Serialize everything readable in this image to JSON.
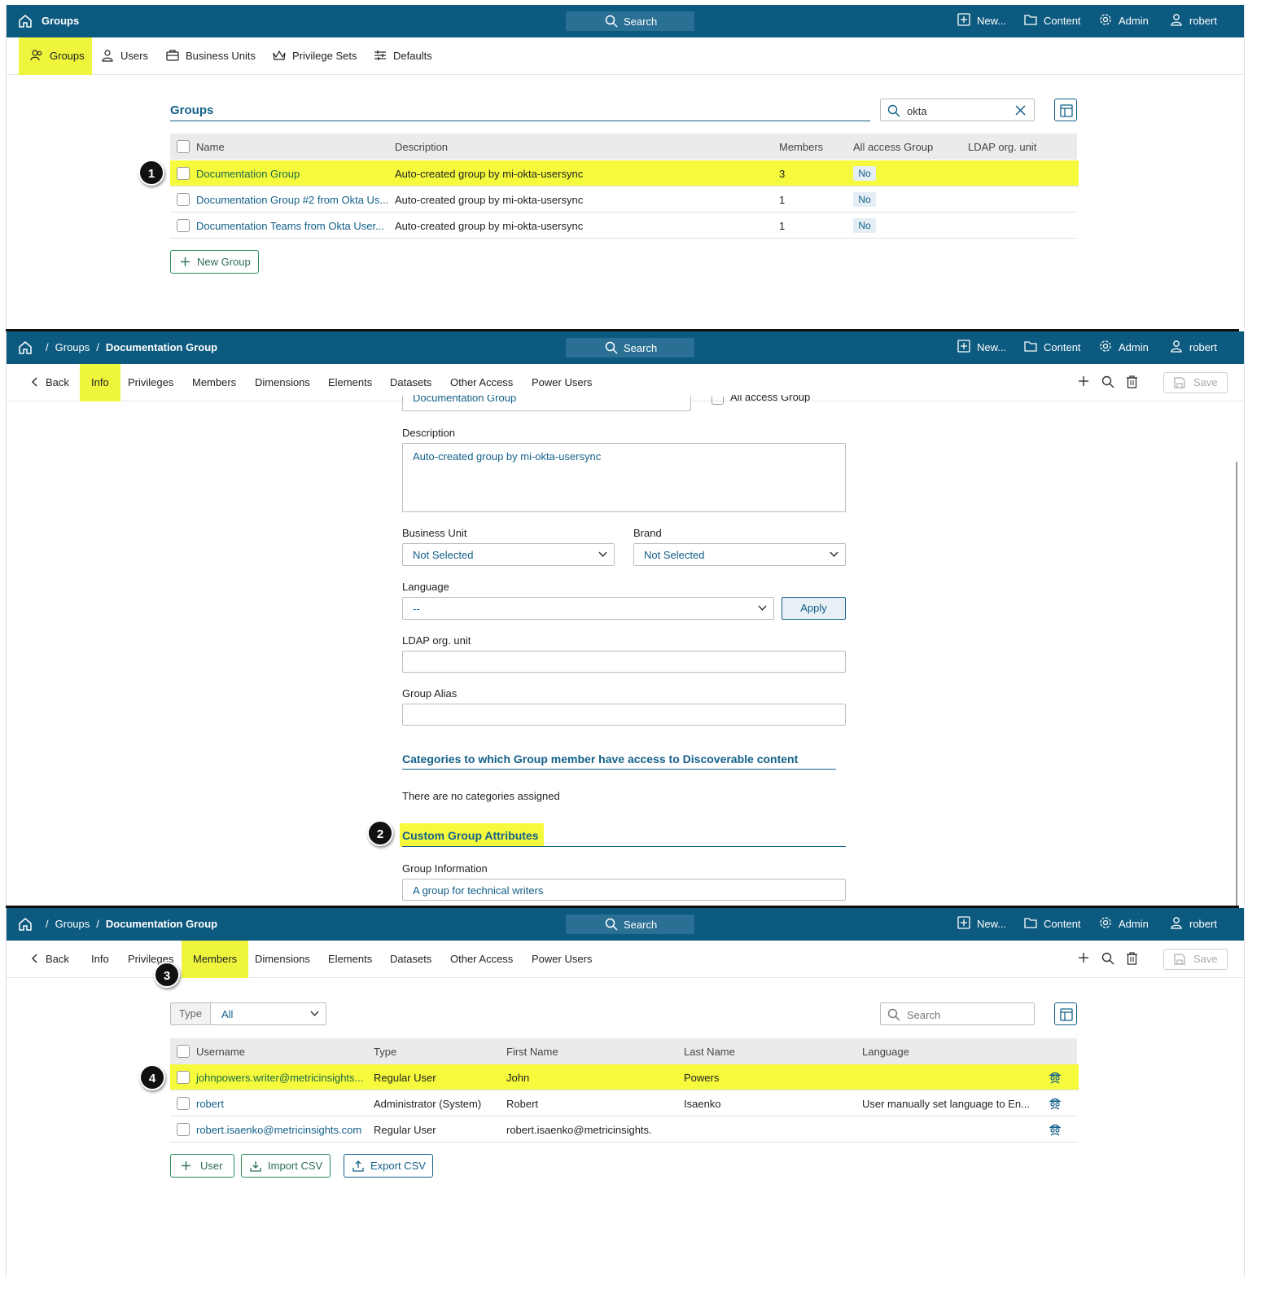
{
  "topbar": {
    "search": "Search",
    "new": "New...",
    "content": "Content",
    "admin": "Admin",
    "user": "robert"
  },
  "panel1": {
    "title": "Groups",
    "tabs": [
      "Groups",
      "Users",
      "Business Units",
      "Privilege Sets",
      "Defaults"
    ],
    "section_title": "Groups",
    "search_value": "okta",
    "columns": [
      "Name",
      "Description",
      "Members",
      "All access Group",
      "LDAP org. unit"
    ],
    "rows": [
      {
        "name": "Documentation Group",
        "description": "Auto-created group by mi-okta-usersync",
        "members": "3",
        "all_access": "No"
      },
      {
        "name": "Documentation Group #2 from Okta Us...",
        "description": "Auto-created group by mi-okta-usersync",
        "members": "1",
        "all_access": "No"
      },
      {
        "name": "Documentation Teams from Okta User...",
        "description": "Auto-created group by mi-okta-usersync",
        "members": "1",
        "all_access": "No"
      }
    ],
    "new_group": "New Group",
    "callout": "1"
  },
  "panel2": {
    "breadcrumb": [
      "Groups",
      "Documentation Group"
    ],
    "tabs": [
      "Back",
      "Info",
      "Privileges",
      "Members",
      "Dimensions",
      "Elements",
      "Datasets",
      "Other Access",
      "Power Users"
    ],
    "save": "Save",
    "name_value_partial": "Documentation Group",
    "all_access_label": "All access Group",
    "description_label": "Description",
    "description_value": "Auto-created group by mi-okta-usersync",
    "business_unit_label": "Business Unit",
    "business_unit_value": "Not Selected",
    "brand_label": "Brand",
    "brand_value": "Not Selected",
    "language_label": "Language",
    "language_value": "--",
    "apply": "Apply",
    "ldap_label": "LDAP org. unit",
    "alias_label": "Group Alias",
    "categories_title": "Categories to which Group member have access to Discoverable content",
    "no_categories": "There are no categories assigned",
    "custom_title": "Custom Group Attributes",
    "group_info_label": "Group Information",
    "group_info_value": "A group for technical writers",
    "callout": "2"
  },
  "panel3": {
    "breadcrumb": [
      "Groups",
      "Documentation Group"
    ],
    "tabs": [
      "Back",
      "Info",
      "Privileges",
      "Members",
      "Dimensions",
      "Elements",
      "Datasets",
      "Other Access",
      "Power Users"
    ],
    "save": "Save",
    "type_label": "Type",
    "type_value": "All",
    "search_placeholder": "Search",
    "columns": [
      "Username",
      "Type",
      "First Name",
      "Last Name",
      "Language"
    ],
    "rows": [
      {
        "username": "johnpowers.writer@metricinsights...",
        "type": "Regular User",
        "first": "John",
        "last": "Powers",
        "language": ""
      },
      {
        "username": "robert",
        "type": "Administrator (System)",
        "first": "Robert",
        "last": "Isaenko",
        "language": "User manually set language to En..."
      },
      {
        "username": "robert.isaenko@metricinsights.com",
        "type": "Regular User",
        "first": "robert.isaenko@metricinsights.",
        "last": "",
        "language": ""
      }
    ],
    "add_user": "User",
    "import_csv": "Import CSV",
    "export_csv": "Export CSV",
    "callout_tab": "3",
    "callout_row": "4"
  },
  "colors": {
    "topbar": "#0d5a80",
    "highlight": "#eef53c",
    "link": "#136089",
    "green": "#2e8b57"
  }
}
